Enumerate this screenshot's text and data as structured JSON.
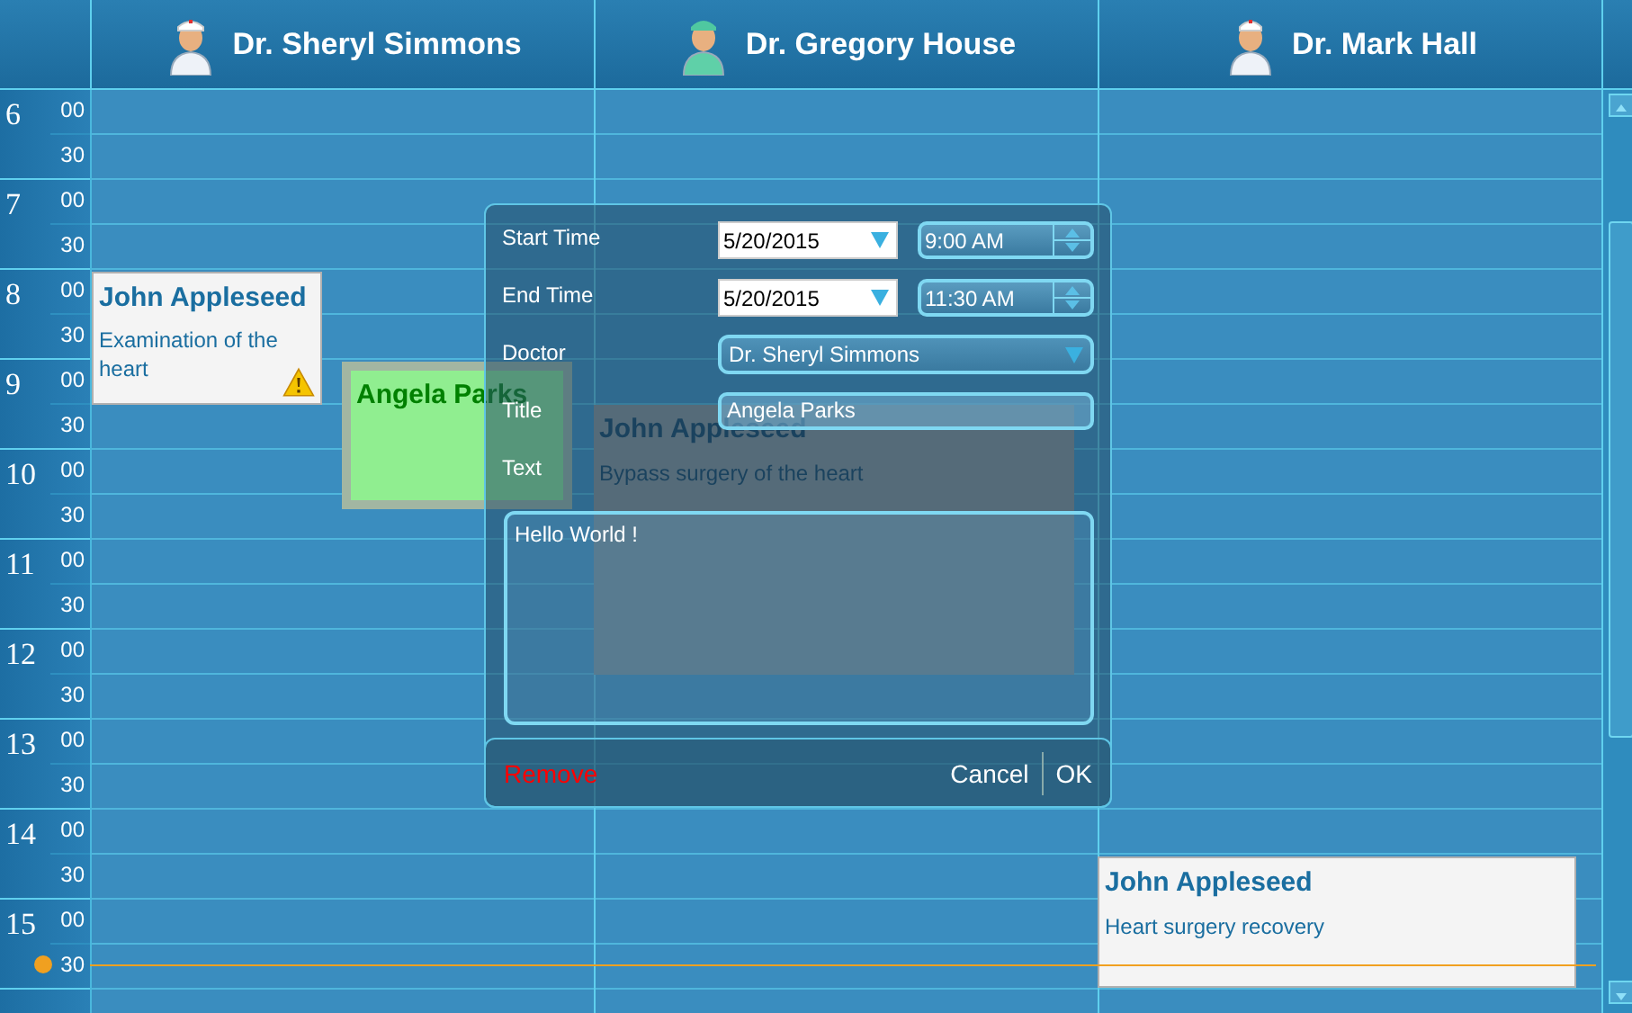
{
  "doctors": [
    {
      "name": "Dr. Sheryl Simmons",
      "kind": "nurse"
    },
    {
      "name": "Dr. Gregory House",
      "kind": "surgeon"
    },
    {
      "name": "Dr. Mark Hall",
      "kind": "doctor"
    }
  ],
  "time_slots": [
    {
      "hour": "6",
      "minutes": [
        "00",
        "30"
      ]
    },
    {
      "hour": "7",
      "minutes": [
        "00",
        "30"
      ]
    },
    {
      "hour": "8",
      "minutes": [
        "00",
        "30"
      ]
    },
    {
      "hour": "9",
      "minutes": [
        "00",
        "30"
      ]
    },
    {
      "hour": "10",
      "minutes": [
        "00",
        "30"
      ]
    },
    {
      "hour": "11",
      "minutes": [
        "00",
        "30"
      ]
    },
    {
      "hour": "12",
      "minutes": [
        "00",
        "30"
      ]
    },
    {
      "hour": "13",
      "minutes": [
        "00",
        "30"
      ]
    },
    {
      "hour": "14",
      "minutes": [
        "00",
        "30"
      ]
    },
    {
      "hour": "15",
      "minutes": [
        "00",
        "30"
      ]
    }
  ],
  "appointments": [
    {
      "kind": "card",
      "title": "John Appleseed",
      "text": "Examination of the heart",
      "warning": true,
      "color": "#f4f4f4"
    },
    {
      "kind": "card",
      "title": "Angela Parks",
      "warning": false,
      "color": "#90ee90"
    },
    {
      "kind": "ghost",
      "title": "John Appleseed",
      "text": "Bypass surgery of the heart",
      "warning": false
    },
    {
      "kind": "card",
      "title": "John Appleseed",
      "text": "Heart surgery recovery",
      "warning": false,
      "color": "#f4f4f4"
    }
  ],
  "dialog": {
    "start_label": "Start Time",
    "start_date": "5/20/2015",
    "start_time": "9:00 AM",
    "end_label": "End Time",
    "end_date": "5/20/2015",
    "end_time": "11:30 AM",
    "doctor_label": "Doctor",
    "doctor": "Dr. Sheryl Simmons",
    "title_label": "Title",
    "title": "Angela Parks",
    "text_label": "Text",
    "text": "Hello World !",
    "buttons": [
      {
        "label": "Remove",
        "kind": "danger"
      },
      {
        "label": "Cancel",
        "kind": "normal"
      },
      {
        "label": "OK",
        "kind": "normal"
      }
    ]
  }
}
